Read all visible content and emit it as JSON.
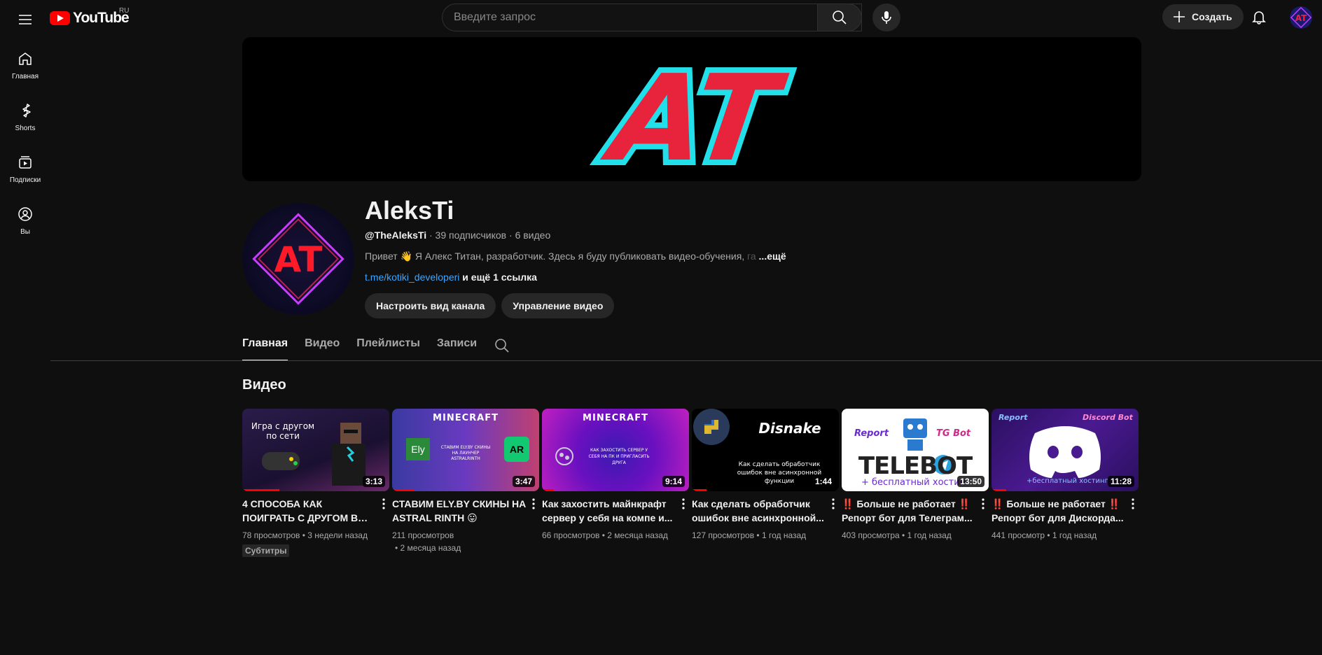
{
  "header": {
    "logo_text": "YouTube",
    "region": "RU",
    "search_placeholder": "Введите запрос",
    "create_label": "Создать"
  },
  "sidebar": {
    "items": [
      {
        "label": "Главная",
        "icon": "home-icon"
      },
      {
        "label": "Shorts",
        "icon": "shorts-icon"
      },
      {
        "label": "Подписки",
        "icon": "subscriptions-icon"
      },
      {
        "label": "Вы",
        "icon": "you-icon"
      }
    ]
  },
  "banner": {
    "text": "AT"
  },
  "channel": {
    "avatar_text": "AT",
    "name": "AleksTi",
    "handle": "@TheAleksTi",
    "subscribers": "39 подписчиков",
    "video_count": "6 видео",
    "description": "Привет 👋 Я Алекс Титан, разработчик. Здесь я буду публиковать видео-обучения,",
    "description_fade": " га",
    "description_more": "...ещё",
    "link": "t.me/kotiki_developeri",
    "more_links": "и ещё 1 ссылка",
    "customize_label": "Настроить вид канала",
    "manage_label": "Управление видео"
  },
  "tabs": [
    "Главная",
    "Видео",
    "Плейлисты",
    "Записи"
  ],
  "section": {
    "title": "Видео"
  },
  "videos": [
    {
      "title": "4 СПОСОБА КАК ПОИГРАТЬ С ДРУГОМ В МАЙНКРАФТ...",
      "views": "78 просмотров",
      "age": "3 недели назад",
      "duration": "3:13",
      "badge": "Субтитры",
      "watched": 0.25,
      "thumb_text": "Игра с другом по сети"
    },
    {
      "title": "СТАВИМ ELY.BY СКИНЫ НА ASTRAL RINTH 😛",
      "views": "211 просмотров",
      "age": "• 2 месяца назад",
      "duration": "3:47",
      "badge": "",
      "watched": 0.15,
      "thumb_text": "MINECRAFT",
      "thumb_sub": "СТАВИМ ELY.BY СКИНЫ НА ЛАУНЧЕР ASTRALRINTH",
      "thumb_logo1": "Ely",
      "thumb_logo2": "AR"
    },
    {
      "title": "Как захостить майнкрафт сервер у себя на компе и...",
      "views": "66 просмотров",
      "age": "2 месяца назад",
      "duration": "9:14",
      "badge": "",
      "watched": 0.08,
      "thumb_text": "MINECRAFT",
      "thumb_sub": "КАК ЗАХОСТИТЬ СЕРВЕР У СЕБЯ НА ПК И ПРИГЛАСИТЬ ДРУГА"
    },
    {
      "title": "Как сделать обработчик ошибок вне асинхронной...",
      "views": "127 просмотров",
      "age": "1 год назад",
      "duration": "1:44",
      "badge": "",
      "watched": 0.1,
      "thumb_text": "Disnake",
      "thumb_sub": "Как сделать обработчик ошибок вне асинхронной функции"
    },
    {
      "title": "‼️ Больше не работает ‼️ Репорт бот для Телеграм...",
      "views": "403 просмотра",
      "age": "1 год назад",
      "duration": "13:50",
      "badge": "",
      "watched": 0,
      "thumb_text": "TELEBOT",
      "thumb_left": "Report",
      "thumb_right": "TG Bot",
      "thumb_sub": "+ бесплатный хостинг"
    },
    {
      "title": "‼️ Больше не работает ‼️ Репорт бот для Дискорда...",
      "views": "441 просмотр",
      "age": "1 год назад",
      "duration": "11:28",
      "badge": "",
      "watched": 0.1,
      "thumb_left": "Report",
      "thumb_right": "Discord Bot",
      "thumb_sub": "+бесплатный хостинг"
    }
  ],
  "colors": {
    "accent": "#ff0000",
    "link": "#3ea6ff",
    "banner_red": "#e8233c",
    "banner_cyan": "#22e0ea"
  }
}
